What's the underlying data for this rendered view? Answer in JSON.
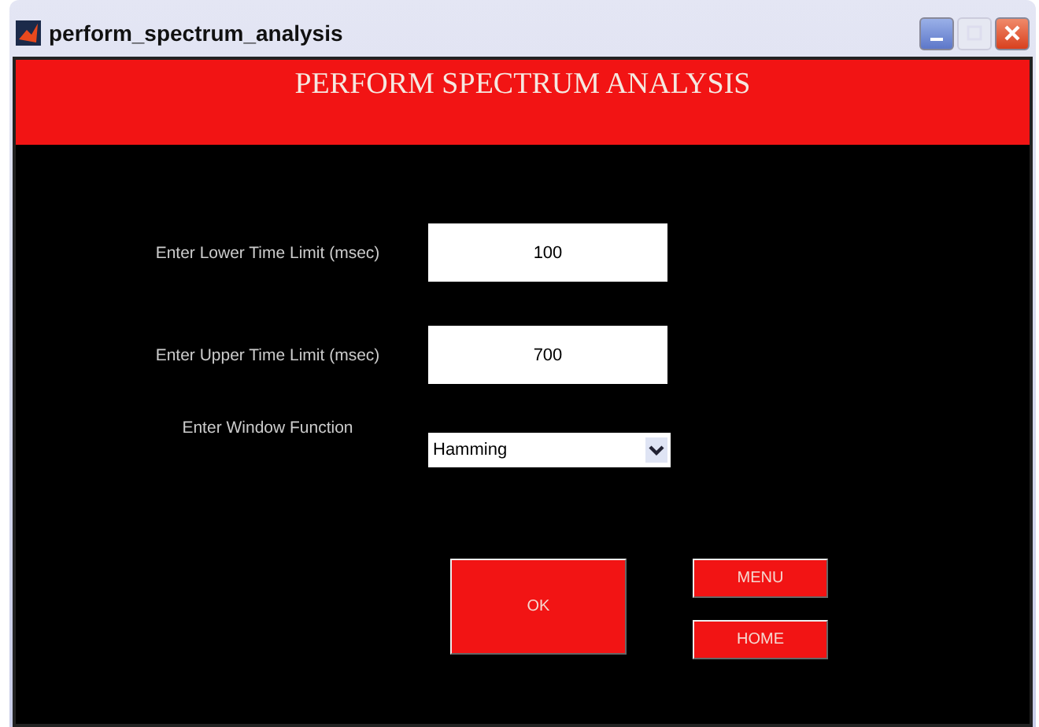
{
  "window": {
    "title": "perform_spectrum_analysis"
  },
  "header": {
    "title": "PERFORM SPECTRUM ANALYSIS"
  },
  "fields": [
    {
      "label": "Enter Lower Time Limit (msec)",
      "value": "100"
    },
    {
      "label": "Enter Upper Time Limit (msec)",
      "value": "700"
    }
  ],
  "window_function": {
    "label": "Enter Window Function",
    "value": "Hamming"
  },
  "buttons": {
    "ok": "OK",
    "menu": "MENU",
    "home": "HOME"
  }
}
